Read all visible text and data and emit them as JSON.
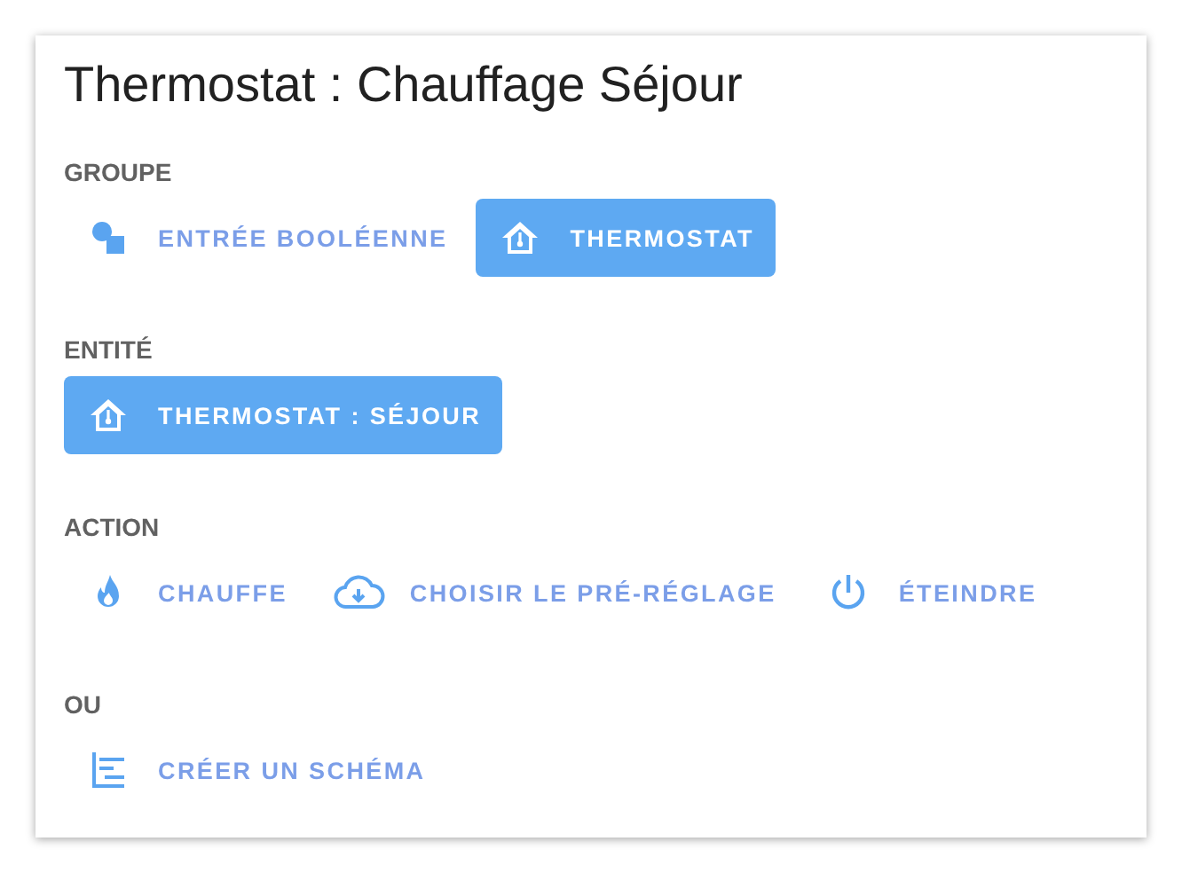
{
  "title": "Thermostat : Chauffage Séjour",
  "sections": [
    {
      "label": "GROUPE",
      "options": [
        {
          "label": "ENTRÉE BOOLÉENNE",
          "kind": "shapes",
          "selected": false
        },
        {
          "label": "THERMOSTAT",
          "kind": "thermostat",
          "selected": true
        }
      ]
    },
    {
      "label": "ENTITÉ",
      "options": [
        {
          "label": "THERMOSTAT : SÉJOUR",
          "kind": "thermostat",
          "selected": true
        }
      ]
    },
    {
      "label": "ACTION",
      "options": [
        {
          "label": "CHAUFFE",
          "kind": "flame",
          "selected": false
        },
        {
          "label": "CHOISIR LE PRÉ-RÉGLAGE",
          "kind": "cloud",
          "selected": false
        },
        {
          "label": "ÉTEINDRE",
          "kind": "power",
          "selected": false
        }
      ]
    },
    {
      "label": "OU",
      "options": [
        {
          "label": "CRÉER UN SCHÉMA",
          "kind": "schema",
          "selected": false
        }
      ]
    }
  ]
}
